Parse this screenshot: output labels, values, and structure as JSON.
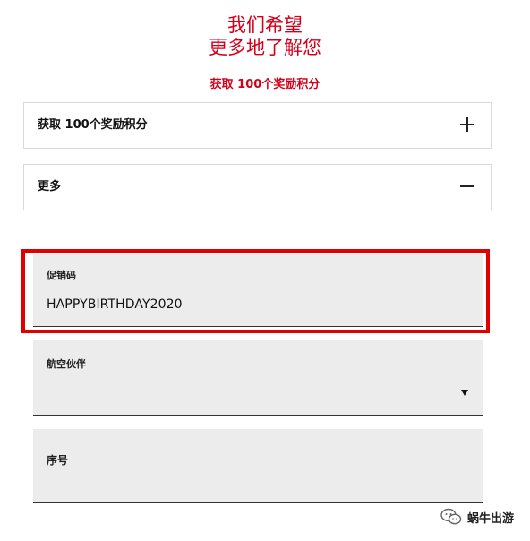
{
  "header": {
    "title_line1": "我们希望",
    "title_line2": "更多地了解您",
    "subtitle": "获取 100个奖励积分"
  },
  "accordion": [
    {
      "label": "获取 100个奖励积分",
      "state": "collapsed",
      "icon": "plus-icon"
    },
    {
      "label": "更多",
      "state": "expanded",
      "icon": "minus-icon"
    }
  ],
  "form": {
    "promo_code": {
      "label": "促销码",
      "value": "HAPPYBIRTHDAY2020"
    },
    "airline_partner": {
      "label": "航空伙伴",
      "value": "",
      "icon": "dropdown-arrow-icon"
    },
    "serial_number": {
      "label": "序号",
      "value": ""
    }
  },
  "watermark": {
    "text": "蜗牛出游",
    "icon": "wechat-icon"
  },
  "colors": {
    "accent": "#d4001a",
    "highlight": "#e00000",
    "field_bg": "#ececec"
  }
}
